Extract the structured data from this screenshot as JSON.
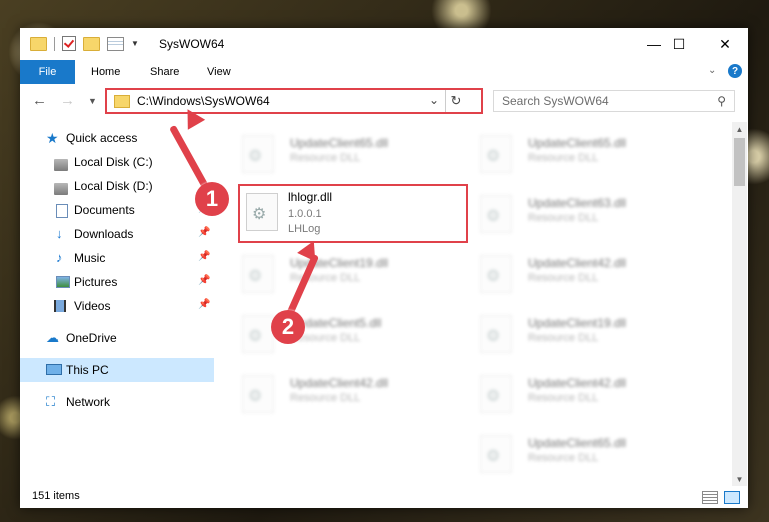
{
  "window": {
    "title": "SysWOW64",
    "minimize": "—",
    "maximize": "☐",
    "close": "✕"
  },
  "ribbon": {
    "tabs": [
      "File",
      "Home",
      "Share",
      "View"
    ],
    "accent_color": "#1979ca",
    "help": "?"
  },
  "address": {
    "path": "C:\\Windows\\SysWOW64",
    "dropdown": "⌄",
    "refresh": "↻"
  },
  "search": {
    "placeholder": "Search SysWOW64",
    "icon": "search-icon"
  },
  "sidebar": {
    "items": [
      {
        "label": "Quick access",
        "icon": "star-icon"
      },
      {
        "label": "Local Disk (C:)",
        "icon": "drive-icon"
      },
      {
        "label": "Local Disk (D:)",
        "icon": "drive-icon"
      },
      {
        "label": "Documents",
        "icon": "documents-icon"
      },
      {
        "label": "Downloads",
        "icon": "download-icon"
      },
      {
        "label": "Music",
        "icon": "music-icon"
      },
      {
        "label": "Pictures",
        "icon": "pictures-icon"
      },
      {
        "label": "Videos",
        "icon": "videos-icon"
      },
      {
        "label": "OneDrive",
        "icon": "cloud-icon"
      },
      {
        "label": "This PC",
        "icon": "computer-icon"
      },
      {
        "label": "Network",
        "icon": "network-icon"
      }
    ],
    "selected": "This PC"
  },
  "files": {
    "left_column": [
      {
        "name": "UpdateClient65.dll",
        "desc": "Resource DLL"
      },
      {
        "name": "UpdateClient19.dll",
        "desc": "Resource DLL"
      },
      {
        "name": "UpdateClient5.dll",
        "desc": "Resource DLL"
      },
      {
        "name": "UpdateClient42.dll",
        "desc": "Resource DLL"
      }
    ],
    "right_column": [
      {
        "name": "UpdateClient65.dll",
        "desc": "Resource DLL"
      },
      {
        "name": "UpdateClient63.dll",
        "desc": "Resource DLL"
      },
      {
        "name": "UpdateClient42.dll",
        "desc": "Resource DLL"
      },
      {
        "name": "UpdateClient19.dll",
        "desc": "Resource DLL"
      },
      {
        "name": "UpdateClient42.dll",
        "desc": "Resource DLL"
      },
      {
        "name": "UpdateClient65.dll",
        "desc": "Resource DLL"
      }
    ],
    "highlighted": {
      "name": "lhlogr.dll",
      "version": "1.0.0.1",
      "company": "LHLog"
    }
  },
  "status": {
    "items_count": "151 items"
  },
  "callouts": {
    "one": "1",
    "two": "2",
    "color": "#e0414a"
  }
}
